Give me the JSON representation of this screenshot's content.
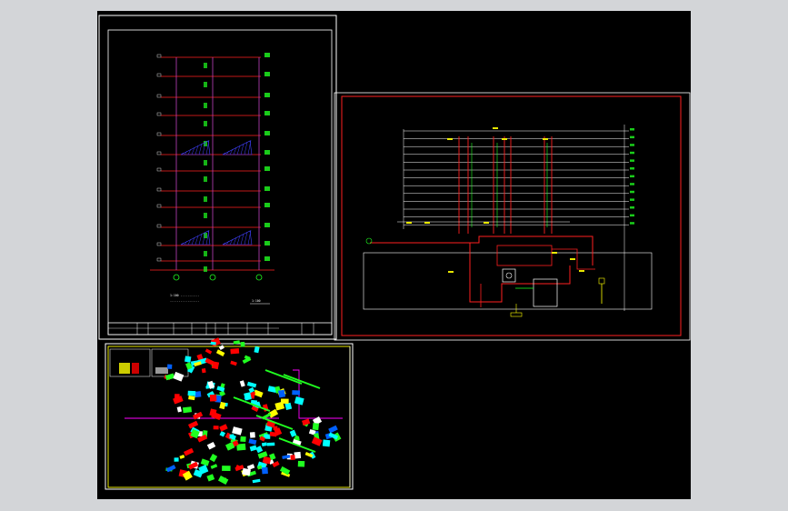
{
  "viewport": {
    "background_color": "#d3d5d8",
    "model_space_color": "#000000"
  },
  "sheets": [
    {
      "id": "elevation-drawing",
      "border_color": "#ffffff",
      "frame_color": "#ffffff",
      "content_colors": {
        "floor_lines": "#ff2020",
        "columns": "#c040c0",
        "symbols": "#20ff20",
        "hatching": "#4040ff"
      },
      "note_line_1": "1:100 ...........",
      "note_line_2": ".................",
      "scale_note": "1:100"
    },
    {
      "id": "pipe-riser-diagram",
      "border_color": "#ff2020",
      "frame_color": "#ff2020",
      "content_colors": {
        "riser": "#ff2020",
        "floors": "#ffffff",
        "pipes": "#20ff20",
        "valves": "#ffff00"
      }
    },
    {
      "id": "fire-sprinkler-layout",
      "border_color": "#ffffff",
      "frame_color": "#ffff00",
      "content_colors": {
        "pipe": "#ff0000",
        "heads": "#00ffff",
        "branches": "#20ff20",
        "main": "#ff00ff",
        "fittings": "#ffff00"
      }
    }
  ],
  "icons": {
    "north-arrow": "circle",
    "axis-bubble": "circle"
  }
}
